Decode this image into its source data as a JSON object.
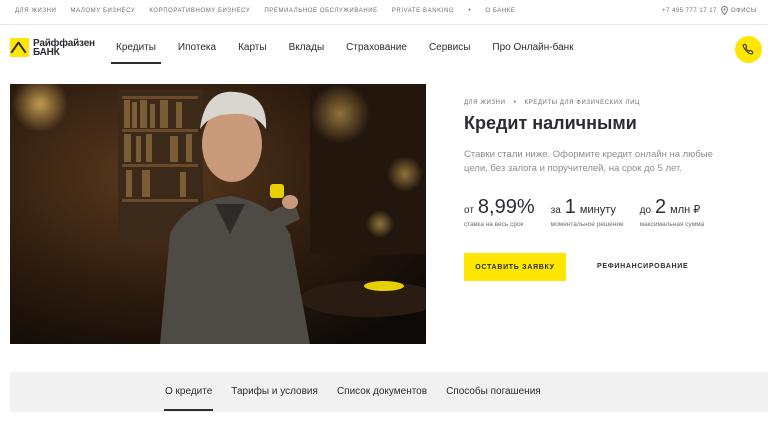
{
  "topbar": {
    "links": [
      "Для жизни",
      "Малому бизнесу",
      "Корпоративному бизнесу",
      "Премиальное обслуживание",
      "Private Banking"
    ],
    "dot": "•",
    "about": "О банке",
    "phone": "+7 495 777 17 17",
    "offices": "Офисы"
  },
  "header": {
    "logo_line1": "Райффайзен",
    "logo_line2": "БАНК",
    "nav": [
      "Кредиты",
      "Ипотека",
      "Карты",
      "Вклады",
      "Страхование",
      "Сервисы",
      "Про Онлайн-банк"
    ],
    "active_nav": "Кредиты"
  },
  "hero": {
    "breadcrumb": [
      "Для жизни",
      "Кредиты для физических лиц"
    ],
    "breadcrumb_sep": "•",
    "title": "Кредит наличными",
    "description": "Ставки стали ниже. Оформите кредит онлайн на любые цели, без залога и поручителей, на срок до 5 лет.",
    "stats": [
      {
        "prefix": "от",
        "value": "8,99%",
        "unit": "",
        "caption": "ставка на весь срок"
      },
      {
        "prefix": "за",
        "value": "1",
        "unit": "минуту",
        "caption": "моментальное решение"
      },
      {
        "prefix": "до",
        "value": "2",
        "unit": "млн ₽",
        "caption": "максимальная сумма"
      }
    ],
    "cta_label": "Оставить заявку",
    "secondary_label": "Рефинансирование"
  },
  "tabs": [
    "О кредите",
    "Тарифы и условия",
    "Список документов",
    "Способы погашения"
  ],
  "active_tab": "О кредите",
  "colors": {
    "brand_yellow": "#fee600",
    "text": "#2b2d33",
    "muted": "#6b6e75"
  }
}
